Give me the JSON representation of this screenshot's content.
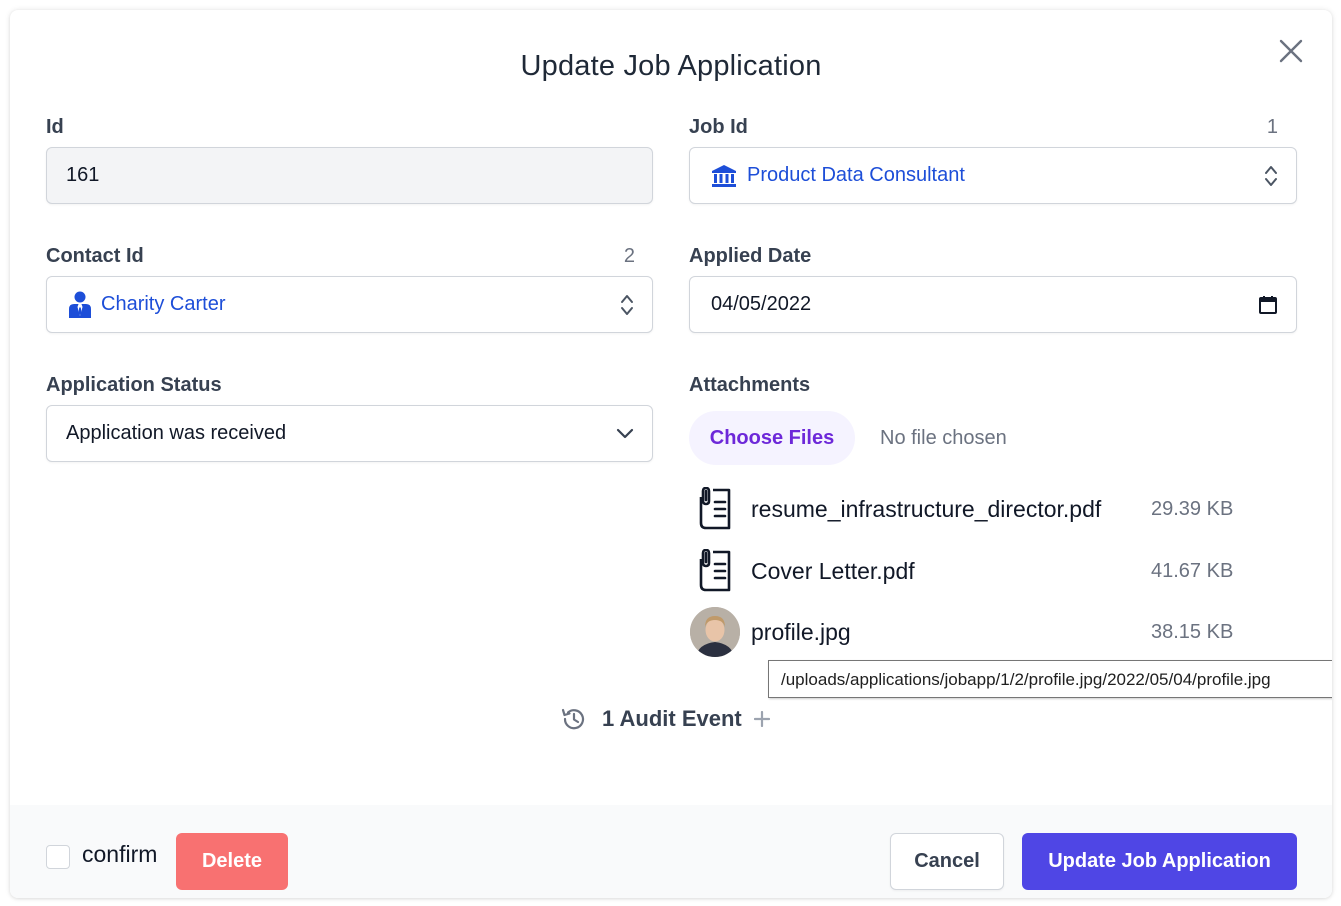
{
  "dialog": {
    "title": "Update Job Application",
    "close_icon": "close-icon"
  },
  "fields": {
    "id": {
      "label": "Id",
      "value": "161"
    },
    "job_id": {
      "label": "Job Id",
      "aside": "1",
      "value": "Product Data Consultant",
      "icon": "bank-building-icon"
    },
    "contact_id": {
      "label": "Contact Id",
      "aside": "2",
      "value": "Charity Carter",
      "icon": "user-tie-icon"
    },
    "applied_date": {
      "label": "Applied Date",
      "value": "04/05/2022",
      "icon": "calendar-icon"
    },
    "application_status": {
      "label": "Application Status",
      "value": "Application was received",
      "icon": "chevron-down-icon"
    }
  },
  "attachments": {
    "label": "Attachments",
    "choose_files": "Choose Files",
    "no_file": "No file chosen",
    "files": [
      {
        "name": "resume_infrastructure_director.pdf",
        "size": "29.39 KB",
        "icon": "document-clip-icon"
      },
      {
        "name": "Cover Letter.pdf",
        "size": "41.67 KB",
        "icon": "document-clip-icon"
      },
      {
        "name": "profile.jpg",
        "size": "38.15 KB",
        "icon": "profile-thumbnail"
      }
    ],
    "tooltip": "/uploads/applications/jobapp/1/2/profile.jpg/2022/05/04/profile.jpg"
  },
  "audit": {
    "label": "1 Audit Event",
    "icon": "history-icon"
  },
  "footer": {
    "confirm_label": "confirm",
    "delete_label": "Delete",
    "cancel_label": "Cancel",
    "update_label": "Update Job Application"
  },
  "colors": {
    "primary": "#4f46e5",
    "danger": "#f87171",
    "link": "#1d4ed8",
    "file_button_bg": "#f5f3ff",
    "file_button_text": "#6d28d9"
  }
}
